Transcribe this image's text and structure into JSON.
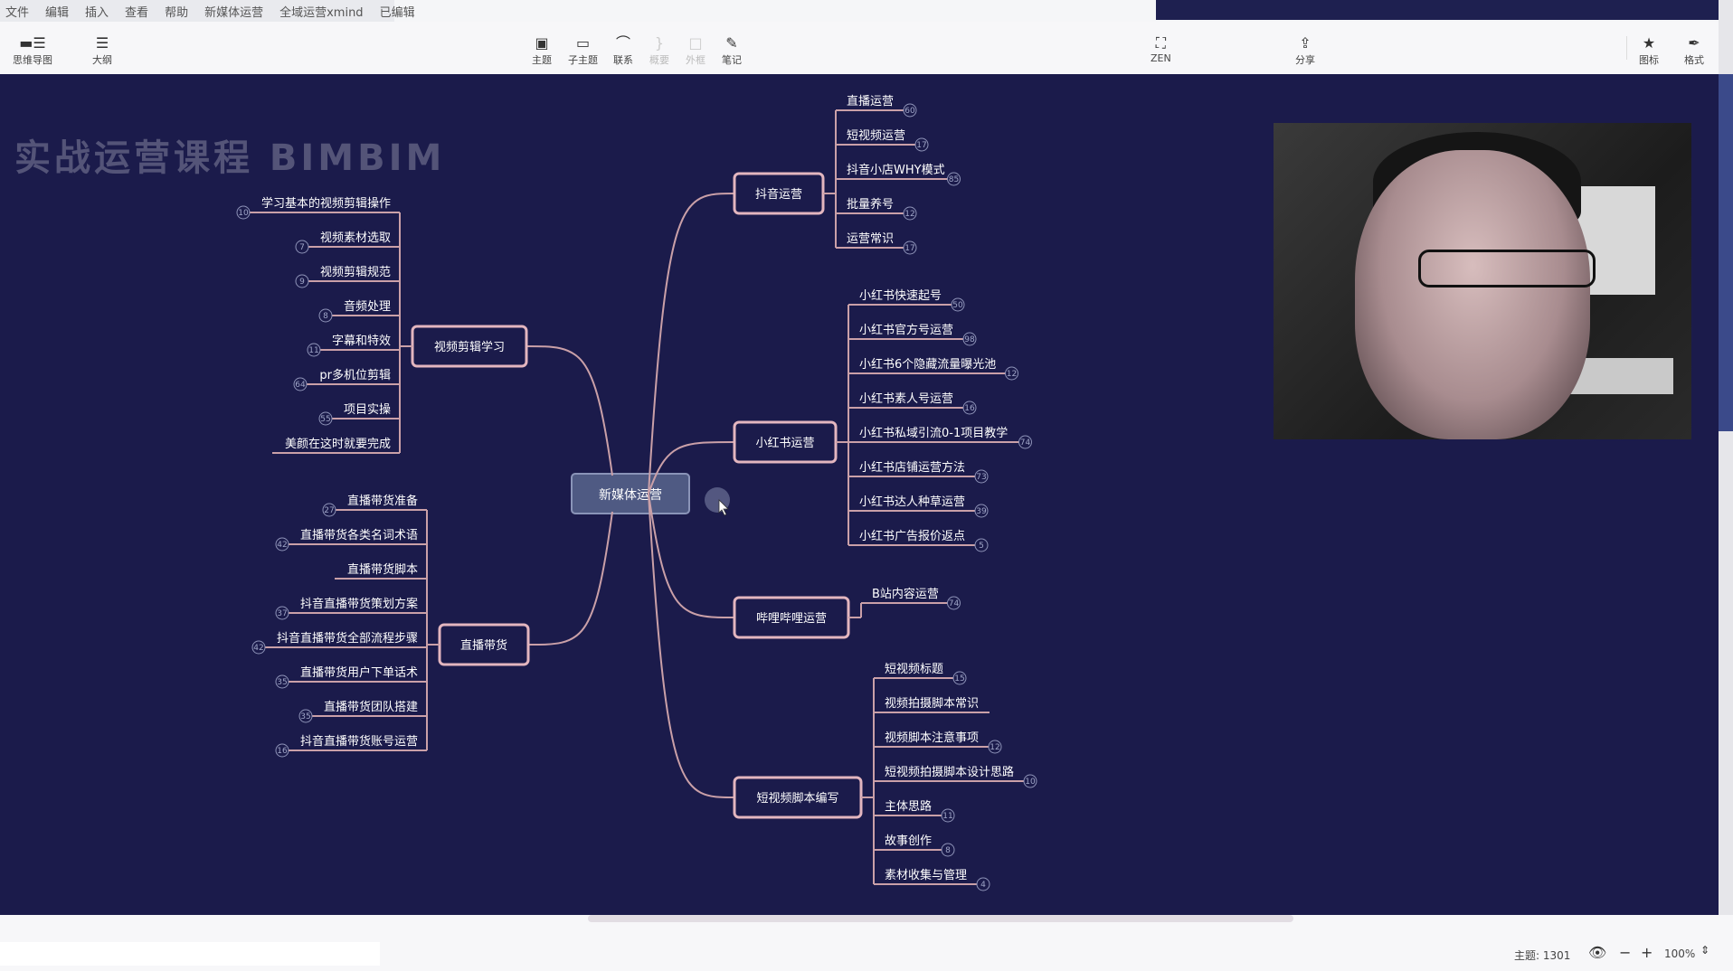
{
  "menubar": {
    "items": [
      "文件",
      "编辑",
      "插入",
      "查看",
      "帮助",
      "新媒体运营",
      "全域运营xmind",
      "已编辑"
    ]
  },
  "toolbar": {
    "left": [
      {
        "icon": "mindmap-icon",
        "label": "思维导图"
      },
      {
        "icon": "outline-icon",
        "label": "大纲"
      }
    ],
    "center": [
      {
        "icon": "topic-icon",
        "label": "主题",
        "enabled": true
      },
      {
        "icon": "subtopic-icon",
        "label": "子主题",
        "enabled": true
      },
      {
        "icon": "relationship-icon",
        "label": "联系",
        "enabled": true
      },
      {
        "icon": "summary-icon",
        "label": "概要",
        "enabled": false
      },
      {
        "icon": "boundary-icon",
        "label": "外框",
        "enabled": false
      },
      {
        "icon": "notes-icon",
        "label": "笔记",
        "enabled": true
      }
    ],
    "zen": {
      "icon": "zen-icon",
      "label": "ZEN"
    },
    "share": {
      "icon": "share-icon",
      "label": "分享"
    },
    "right": [
      {
        "icon": "star-icon",
        "label": "图标"
      },
      {
        "icon": "format-brush-icon",
        "label": "格式"
      }
    ]
  },
  "canvas": {
    "watermark": "实战运营课程 BIMBIM",
    "root": "新媒体运营",
    "right_branches": [
      {
        "label": "抖音运营",
        "children": [
          {
            "label": "直播运营",
            "badge": "60"
          },
          {
            "label": "短视频运营",
            "badge": "17"
          },
          {
            "label": "抖音小店WHY模式",
            "badge": "85"
          },
          {
            "label": "批量养号",
            "badge": "12"
          },
          {
            "label": "运营常识",
            "badge": "17"
          }
        ]
      },
      {
        "label": "小红书运营",
        "children": [
          {
            "label": "小红书快速起号",
            "badge": "50"
          },
          {
            "label": "小红书官方号运营",
            "badge": "98"
          },
          {
            "label": "小红书6个隐藏流量曝光池",
            "badge": "12"
          },
          {
            "label": "小红书素人号运营",
            "badge": "16"
          },
          {
            "label": "小红书私域引流0-1项目教学",
            "badge": "74"
          },
          {
            "label": "小红书店铺运营方法",
            "badge": "73"
          },
          {
            "label": "小红书达人种草运营",
            "badge": "39"
          },
          {
            "label": "小红书广告报价返点",
            "badge": "5"
          }
        ]
      },
      {
        "label": "哔哩哔哩运营",
        "children": [
          {
            "label": "B站内容运营",
            "badge": "74"
          }
        ]
      },
      {
        "label": "短视频脚本编写",
        "children": [
          {
            "label": "短视频标题",
            "badge": "15"
          },
          {
            "label": "视频拍摄脚本常识",
            "badge": ""
          },
          {
            "label": "视频脚本注意事项",
            "badge": "12"
          },
          {
            "label": "短视频拍摄脚本设计思路",
            "badge": "10"
          },
          {
            "label": "主体思路",
            "badge": "11"
          },
          {
            "label": "故事创作",
            "badge": "8"
          },
          {
            "label": "素材收集与管理",
            "badge": "4"
          }
        ]
      }
    ],
    "left_branches": [
      {
        "label": "视频剪辑学习",
        "children": [
          {
            "label": "学习基本的视频剪辑操作",
            "badge": "10"
          },
          {
            "label": "视频素材选取",
            "badge": "7"
          },
          {
            "label": "视频剪辑规范",
            "badge": "9"
          },
          {
            "label": "音频处理",
            "badge": "8"
          },
          {
            "label": "字幕和特效",
            "badge": "11"
          },
          {
            "label": "pr多机位剪辑",
            "badge": "64"
          },
          {
            "label": "项目实操",
            "badge": "55"
          },
          {
            "label": "美颜在这时就要完成",
            "badge": ""
          }
        ]
      },
      {
        "label": "直播带货",
        "children": [
          {
            "label": "直播带货准备",
            "badge": "27"
          },
          {
            "label": "直播带货各类名词术语",
            "badge": "42"
          },
          {
            "label": "直播带货脚本",
            "badge": ""
          },
          {
            "label": "抖音直播带货策划方案",
            "badge": "37"
          },
          {
            "label": "抖音直播带货全部流程步骤",
            "badge": "42"
          },
          {
            "label": "直播带货用户下单话术",
            "badge": "35"
          },
          {
            "label": "直播带货团队搭建",
            "badge": "35"
          },
          {
            "label": "抖音直播带货账号运营",
            "badge": "16"
          }
        ]
      }
    ]
  },
  "status": {
    "topic_count": "主题: 1301",
    "zoom": "100%",
    "zoom_out": "−",
    "zoom_in": "+"
  },
  "colors": {
    "canvas_bg": "#1b1b4b",
    "line": "#caa0a8",
    "node_border": "#e3b6bf",
    "root_bg": "#4f5a83"
  }
}
